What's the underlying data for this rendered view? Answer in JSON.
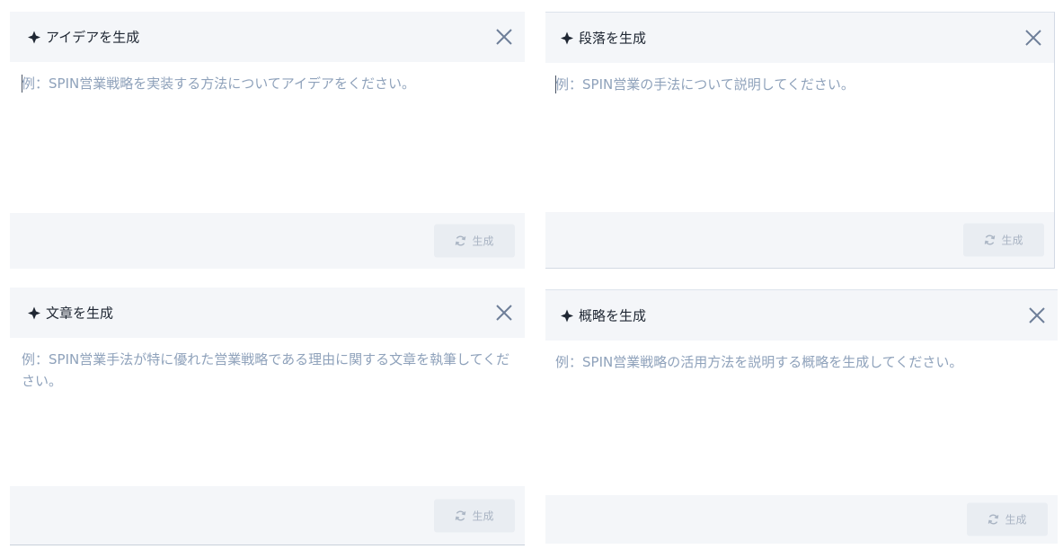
{
  "panels": [
    {
      "title": "アイデアを生成",
      "placeholder": "例：SPIN営業戦略を実装する方法についてアイデアをください。",
      "button_label": "生成"
    },
    {
      "title": "段落を生成",
      "placeholder": "例：SPIN営業の手法について説明してください。",
      "button_label": "生成"
    },
    {
      "title": "文章を生成",
      "placeholder": "例：SPIN営業手法が特に優れた営業戦略である理由に関する文章を執筆してください。",
      "button_label": "生成"
    },
    {
      "title": "概略を生成",
      "placeholder": "例：SPIN営業戦略の活用方法を説明する概略を生成してください。",
      "button_label": "生成"
    }
  ],
  "icons": {
    "title": "sparkle-icon",
    "close": "close-icon",
    "button": "refresh-icon"
  },
  "colors": {
    "header_bg": "#f4f6f9",
    "title_text": "#1f2733",
    "placeholder_text": "#8fa2bb",
    "close_icon": "#6e7f99",
    "button_bg": "#e9edf2",
    "button_text": "#a9b4c3"
  }
}
